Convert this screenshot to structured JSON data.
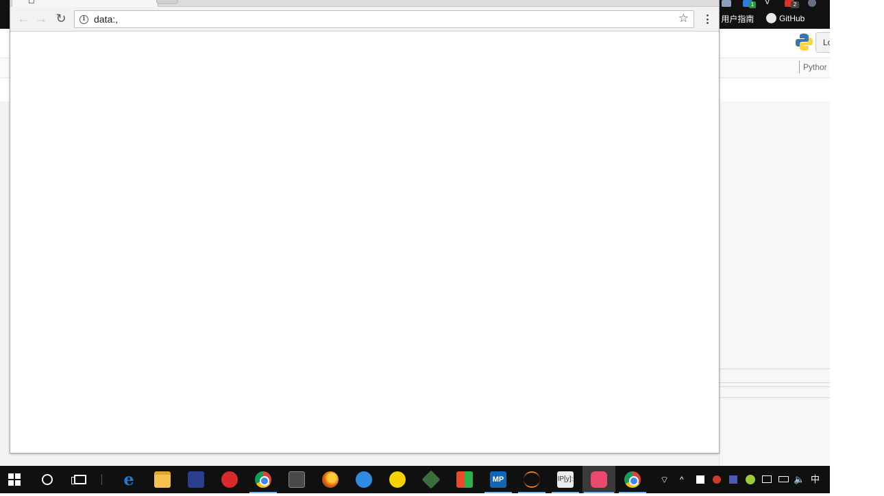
{
  "background_browser": {
    "bookmarks": [
      {
        "label": "r 用户指南"
      },
      {
        "label": "GitHub"
      }
    ],
    "login_button": {
      "label": "Lo"
    },
    "python_tab": {
      "label": "Pythor"
    },
    "extension_badges": [
      "1",
      "2"
    ]
  },
  "front_window": {
    "url": "data:,",
    "icons": {
      "back": "←",
      "forward": "→",
      "reload": "↻",
      "info": "i",
      "star": "☆"
    }
  },
  "taskbar": {
    "apps": [
      {
        "name": "edge-icon",
        "label": "e"
      },
      {
        "name": "mp-icon",
        "label": "MP"
      },
      {
        "name": "ipython-icon",
        "label": "IP[y]:"
      }
    ],
    "tray": {
      "wifi": "⌔",
      "chevron": "^",
      "volume": "🔈",
      "ime": "中"
    }
  }
}
